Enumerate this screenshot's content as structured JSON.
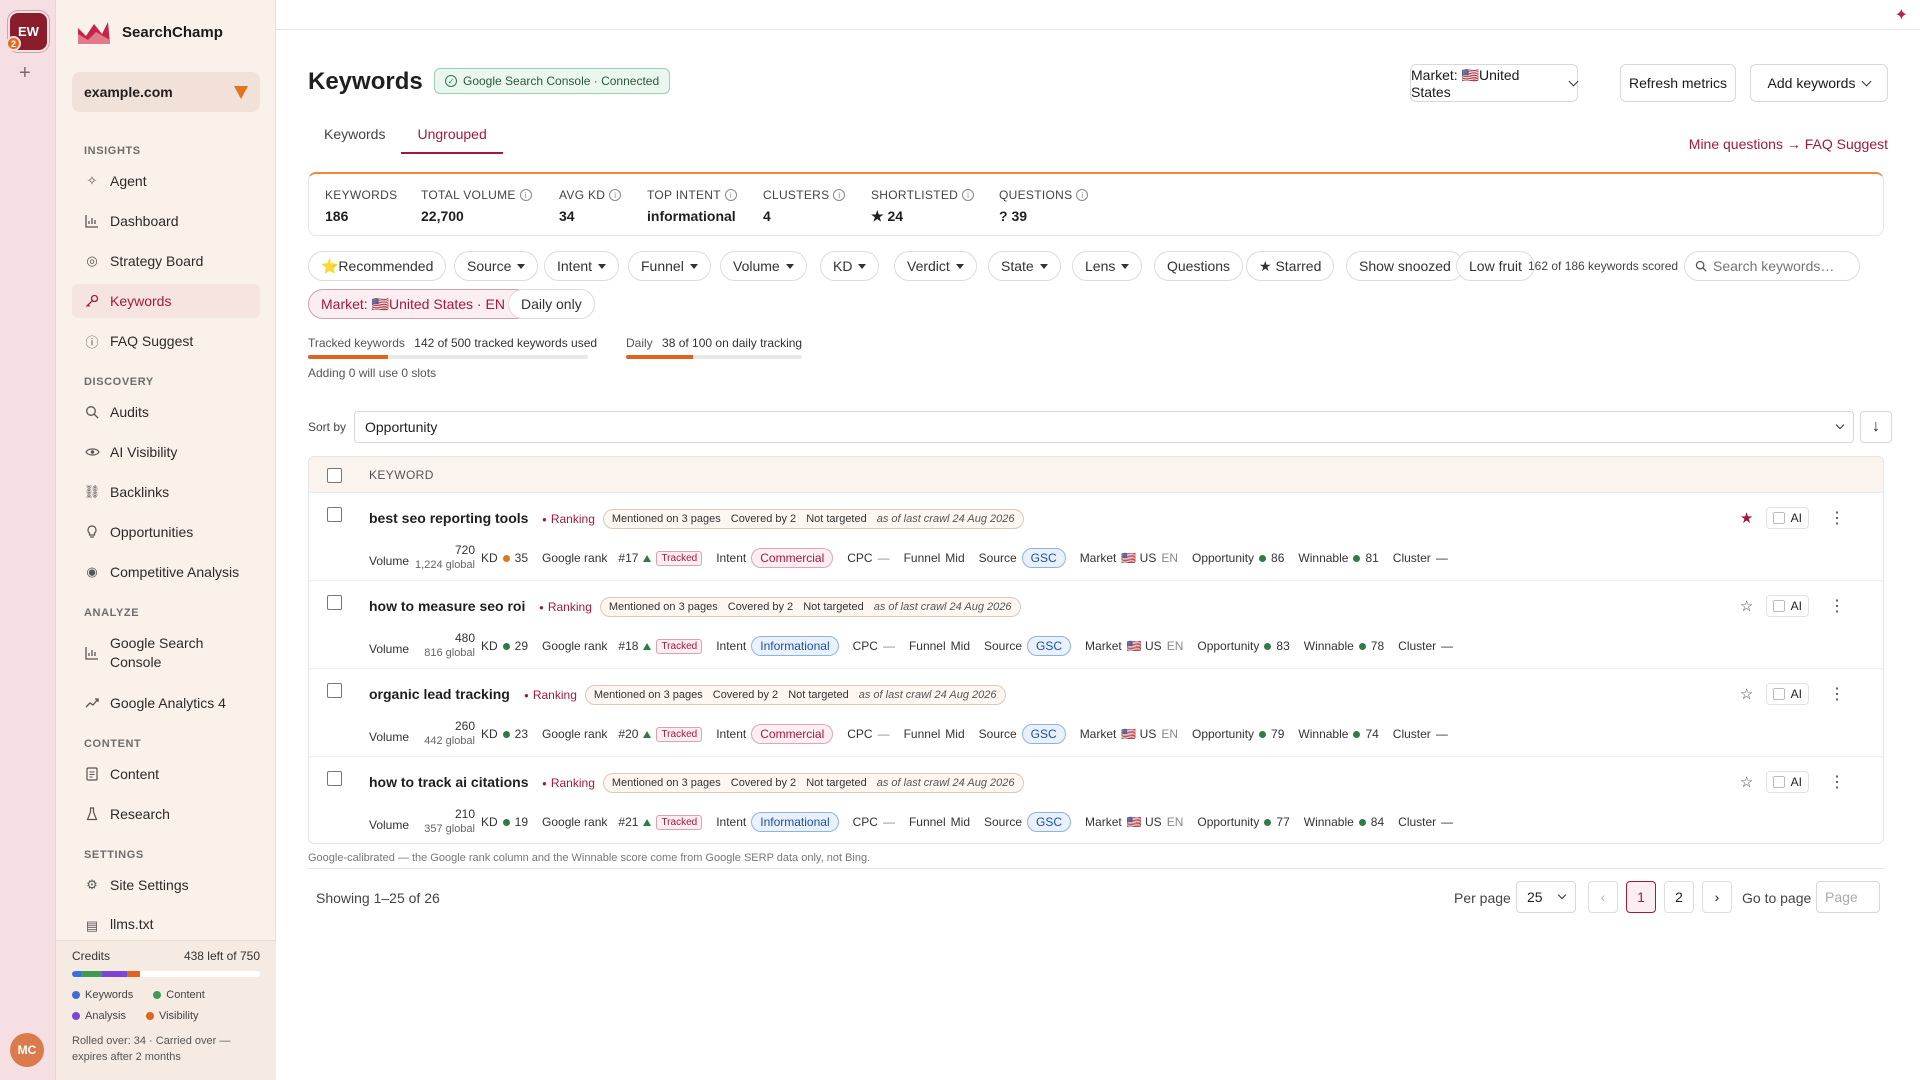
{
  "workspace": {
    "initials": "EW",
    "badge": "2",
    "add": "+"
  },
  "user": {
    "initials": "MC"
  },
  "brand": {
    "name": "SearchChamp"
  },
  "site": {
    "name": "example.com"
  },
  "nav": {
    "insights_label": "INSIGHTS",
    "discovery_label": "DISCOVERY",
    "analyze_label": "ANALYZE",
    "content_label": "CONTENT",
    "settings_label": "SETTINGS",
    "items": {
      "agent": "Agent",
      "dashboard": "Dashboard",
      "strategy": "Strategy Board",
      "keywords": "Keywords",
      "faq": "FAQ Suggest",
      "audits": "Audits",
      "ai_visibility": "AI Visibility",
      "backlinks": "Backlinks",
      "opportunities": "Opportunities",
      "competitive": "Competitive Analysis",
      "gsc": "Google Search Console",
      "ga4": "Google Analytics 4",
      "content": "Content",
      "research": "Research",
      "site_settings": "Site Settings",
      "llms": "llms.txt"
    }
  },
  "credits": {
    "label": "Credits",
    "remaining": "438 left of 750",
    "segments": [
      {
        "name": "Keywords",
        "color": "#3b6fd6",
        "fraction": 0.05
      },
      {
        "name": "Content",
        "color": "#3f9a57",
        "fraction": 0.11
      },
      {
        "name": "Analysis",
        "color": "#7b45d6",
        "fraction": 0.13
      },
      {
        "name": "Visibility",
        "color": "#e0641f",
        "fraction": 0.07
      }
    ],
    "legend": {
      "keywords": "Keywords",
      "content": "Content",
      "analysis": "Analysis",
      "visibility": "Visibility"
    },
    "note": "Rolled over: 34 · Carried over — expires after 2 months"
  },
  "header": {
    "title": "Keywords",
    "gsc_status": "Google Search Console · Connected",
    "market_button": "Market: 🇺🇸United States",
    "refresh_button": "Refresh metrics",
    "add_button": "Add keywords"
  },
  "tabs": {
    "keywords": "Keywords",
    "ungrouped": "Ungrouped"
  },
  "faq_link": "Mine questions → FAQ Suggest",
  "stats": {
    "keywords": {
      "label": "KEYWORDS",
      "value": "186"
    },
    "volume": {
      "label": "TOTAL VOLUME",
      "value": "22,700"
    },
    "kd": {
      "label": "AVG KD",
      "value": "34"
    },
    "intent": {
      "label": "TOP INTENT",
      "value": "informational"
    },
    "clusters": {
      "label": "CLUSTERS",
      "value": "4"
    },
    "shortlisted": {
      "label": "SHORTLISTED",
      "value": "★ 24"
    },
    "questions": {
      "label": "QUESTIONS",
      "value": "? 39"
    }
  },
  "filters": {
    "recommended": "⭐Recommended",
    "source": "Source",
    "intent": "Intent",
    "funnel": "Funnel",
    "volume": "Volume",
    "kd": "KD",
    "verdict": "Verdict",
    "state": "State",
    "lens": "Lens",
    "questions": "Questions",
    "starred": "★ Starred",
    "snoozed": "Show snoozed",
    "low_fruit": "Low fruit",
    "scored": "162 of 186 keywords scored",
    "search_placeholder": "Search keywords…",
    "market": "Market: 🇺🇸United States · EN",
    "daily_only": "Daily only"
  },
  "quota": {
    "tracked_label": "Tracked keywords",
    "tracked_value": "142 of 500 tracked keywords used",
    "tracked_fraction": 0.284,
    "daily_label": "Daily",
    "daily_value": "38 of 100 on daily tracking",
    "daily_fraction": 0.38,
    "adding_note": "Adding 0 will use 0 slots"
  },
  "sort": {
    "label": "Sort by",
    "value": "Opportunity",
    "direction": "↓"
  },
  "table": {
    "header": "KEYWORD",
    "labels": {
      "ranking": "Ranking",
      "volume": "Volume",
      "kd": "KD",
      "google_rank": "Google rank",
      "tracked": "Tracked",
      "intent": "Intent",
      "cpc": "CPC",
      "cpc_value": "—",
      "funnel": "Funnel",
      "source": "Source",
      "market": "Market",
      "opportunity": "Opportunity",
      "winnable": "Winnable",
      "cluster": "Cluster",
      "cluster_value": "—",
      "ai": "AI"
    },
    "rows": [
      {
        "keyword": "best seo reporting tools",
        "mentioned": "Mentioned on 3 pages",
        "covered": "Covered by 2",
        "targeted": "Not targeted",
        "crawl": "as of last crawl 24 Aug 2026",
        "volume": "720",
        "global": "1,224 global",
        "kd": "35",
        "kd_color": "orange",
        "rank": "#17",
        "intent": "Commercial",
        "funnel": "Mid",
        "source": "GSC",
        "market": "🇺🇸 US",
        "lang": "EN",
        "opportunity": "86",
        "winnable": "81",
        "starred": true,
        "star": "★"
      },
      {
        "keyword": "how to measure seo roi",
        "mentioned": "Mentioned on 3 pages",
        "covered": "Covered by 2",
        "targeted": "Not targeted",
        "crawl": "as of last crawl 24 Aug 2026",
        "volume": "480",
        "global": "816 global",
        "kd": "29",
        "kd_color": "green",
        "rank": "#18",
        "intent": "Informational",
        "funnel": "Mid",
        "source": "GSC",
        "market": "🇺🇸 US",
        "lang": "EN",
        "opportunity": "83",
        "winnable": "78",
        "starred": false,
        "star": "☆"
      },
      {
        "keyword": "organic lead tracking",
        "mentioned": "Mentioned on 3 pages",
        "covered": "Covered by 2",
        "targeted": "Not targeted",
        "crawl": "as of last crawl 24 Aug 2026",
        "volume": "260",
        "global": "442 global",
        "kd": "23",
        "kd_color": "green",
        "rank": "#20",
        "intent": "Commercial",
        "funnel": "Mid",
        "source": "GSC",
        "market": "🇺🇸 US",
        "lang": "EN",
        "opportunity": "79",
        "winnable": "74",
        "starred": false,
        "star": "☆"
      },
      {
        "keyword": "how to track ai citations",
        "mentioned": "Mentioned on 3 pages",
        "covered": "Covered by 2",
        "targeted": "Not targeted",
        "crawl": "as of last crawl 24 Aug 2026",
        "volume": "210",
        "global": "357 global",
        "kd": "19",
        "kd_color": "green",
        "rank": "#21",
        "intent": "Informational",
        "funnel": "Mid",
        "source": "GSC",
        "market": "🇺🇸 US",
        "lang": "EN",
        "opportunity": "77",
        "winnable": "84",
        "starred": false,
        "star": "☆"
      }
    ]
  },
  "footnote": "Google-calibrated — the Google rank column and the Winnable score come from Google SERP data only, not Bing.",
  "pagination": {
    "showing": "Showing 1–25 of 26",
    "per_page_label": "Per page",
    "per_page": "25",
    "prev": "‹",
    "pages": [
      "1",
      "2"
    ],
    "next": "›",
    "goto_label": "Go to page",
    "goto_placeholder": "Page"
  },
  "colors": {
    "accent": "#a11a3d",
    "orange": "#e0641f",
    "green": "#2f7a45"
  }
}
